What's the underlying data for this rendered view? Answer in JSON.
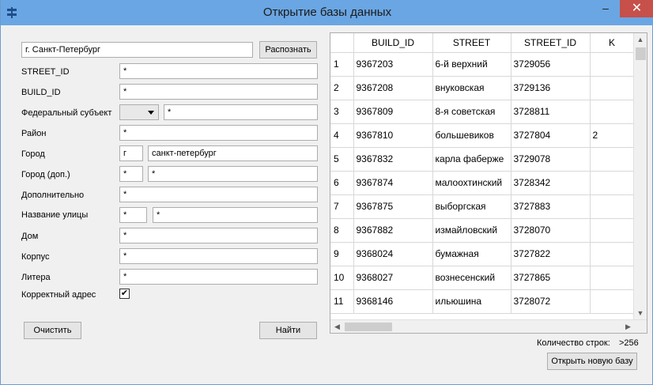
{
  "window": {
    "title": "Открытие базы данных"
  },
  "address": {
    "value": "г. Санкт-Петербург",
    "recognize_label": "Распознать"
  },
  "fields": [
    {
      "label": "STREET_ID",
      "value": "*"
    },
    {
      "label": "BUILD_ID",
      "value": "*"
    },
    {
      "label": "Федеральный субъект",
      "combo": "",
      "value": "*"
    },
    {
      "label": "Район",
      "value": "*"
    },
    {
      "label": "Город",
      "prefix": "г",
      "value": "санкт-петербург"
    },
    {
      "label": "Город (доп.)",
      "prefix": "*",
      "value": "*"
    },
    {
      "label": "Дополнительно",
      "value": "*"
    },
    {
      "label": "Название улицы",
      "prefix": "*",
      "value": "*"
    },
    {
      "label": "Дом",
      "value": "*"
    },
    {
      "label": "Корпус",
      "value": "*"
    },
    {
      "label": "Литера",
      "value": "*"
    }
  ],
  "valid_address": {
    "label": "Корректный адрес",
    "checked": "✔"
  },
  "buttons": {
    "clear": "Очистить",
    "find": "Найти",
    "open_new": "Открыть новую базу"
  },
  "row_count": {
    "label": "Количество строк:",
    "value": ">256"
  },
  "table": {
    "columns": [
      "BUILD_ID",
      "STREET",
      "STREET_ID",
      "K"
    ],
    "rows": [
      [
        "1",
        "9367203",
        "6-й верхний",
        "3729056",
        ""
      ],
      [
        "2",
        "9367208",
        "внуковская",
        "3729136",
        ""
      ],
      [
        "3",
        "9367809",
        "8-я советская",
        "3728811",
        ""
      ],
      [
        "4",
        "9367810",
        "большевиков",
        "3727804",
        "2"
      ],
      [
        "5",
        "9367832",
        "карла фаберже",
        "3729078",
        ""
      ],
      [
        "6",
        "9367874",
        "малоохтинский",
        "3728342",
        ""
      ],
      [
        "7",
        "9367875",
        "выборгская",
        "3727883",
        ""
      ],
      [
        "8",
        "9367882",
        "измайловский",
        "3728070",
        ""
      ],
      [
        "9",
        "9368024",
        "бумажная",
        "3727822",
        ""
      ],
      [
        "10",
        "9368027",
        "вознесенский",
        "3727865",
        ""
      ],
      [
        "11",
        "9368146",
        "ильюшина",
        "3728072",
        ""
      ]
    ]
  }
}
